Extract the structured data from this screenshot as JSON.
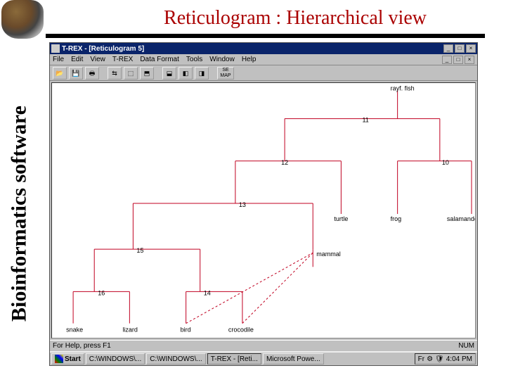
{
  "slide": {
    "title": "Reticulogram : Hierarchical view",
    "side_label": "Bioinformatics software"
  },
  "window": {
    "app_title": "T-REX - [Reticulogram 5]",
    "sysbtn_min": "_",
    "sysbtn_max": "□",
    "sysbtn_close": "×"
  },
  "menubar": {
    "file": "File",
    "edit": "Edit",
    "view": "View",
    "trex": "T-REX",
    "dataformat": "Data Format",
    "tools": "Tools",
    "window": "Window",
    "help": "Help"
  },
  "toolbar": {
    "open": "📂",
    "save": "💾",
    "print": "🖶",
    "b1": "⇆",
    "b2": "⬚",
    "b3": "⬒",
    "b4": "⬓",
    "b5": "◧",
    "b6": "◨",
    "maplabel": "SE\nMAP"
  },
  "statusbar": {
    "hint": "For Help, press F1",
    "num": "NUM"
  },
  "taskbar": {
    "start": "Start",
    "btn1": "C:\\WINDOWS\\...",
    "btn2": "C:\\WINDOWS\\...",
    "btn3": "T-REX - [Reti...",
    "btn4": "Microsoft Powe...",
    "clock": "4:04 PM",
    "lang": "Fr"
  },
  "tree": {
    "leaves": {
      "rayf_fish": "rayf. fish",
      "turtle": "turtle",
      "frog": "frog",
      "salamander": "salamander",
      "snake": "snake",
      "lizard": "lizard",
      "bird": "bird",
      "crocodile": "crocodile",
      "mammal": "mammal"
    },
    "nodes": {
      "n10": "10",
      "n11": "11",
      "n12": "12",
      "n13": "13",
      "n14": "14",
      "n15": "15",
      "n16": "16"
    }
  },
  "chart_data": {
    "type": "tree_reticulogram",
    "title": "Reticulogram 5 - Hierarchical view",
    "leaves": [
      "rayf. fish",
      "turtle",
      "frog",
      "salamander",
      "snake",
      "lizard",
      "bird",
      "crocodile",
      "mammal"
    ],
    "internal_nodes": [
      10,
      11,
      12,
      13,
      14,
      15,
      16
    ],
    "tree_edges": [
      [
        "root",
        "rayf. fish"
      ],
      [
        "root",
        11
      ],
      [
        11,
        12
      ],
      [
        11,
        10
      ],
      [
        10,
        "frog"
      ],
      [
        10,
        "salamander"
      ],
      [
        12,
        13
      ],
      [
        12,
        "turtle"
      ],
      [
        13,
        15
      ],
      [
        13,
        "mammal"
      ],
      [
        15,
        16
      ],
      [
        15,
        14
      ],
      [
        16,
        "snake"
      ],
      [
        16,
        "lizard"
      ],
      [
        14,
        "bird"
      ],
      [
        14,
        "crocodile"
      ]
    ],
    "reticulation_edges": [
      [
        "crocodile",
        "mammal"
      ],
      [
        "bird",
        "mammal"
      ]
    ]
  }
}
